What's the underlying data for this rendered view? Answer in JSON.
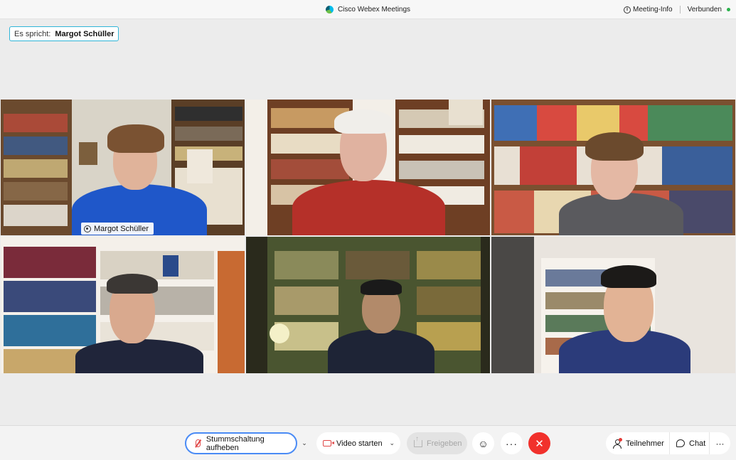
{
  "window": {
    "app_title": "Cisco Webex Meetings",
    "meeting_info_label": "Meeting-Info",
    "status_label": "Verbunden"
  },
  "speaking": {
    "prefix": "Es spricht:",
    "name": "Margot Schüller"
  },
  "tiles": [
    {
      "name_label": "Margot Schüller",
      "active_speaker": true
    },
    {
      "name_label": "",
      "active_speaker": false
    },
    {
      "name_label": "",
      "active_speaker": false
    },
    {
      "name_label": "",
      "active_speaker": false
    },
    {
      "name_label": "",
      "active_speaker": false
    },
    {
      "name_label": "",
      "active_speaker": false
    }
  ],
  "toolbar": {
    "unmute_label": "Stummschaltung aufheben",
    "video_label": "Video starten",
    "share_label": "Freigeben",
    "more_glyph": "···",
    "participants_label": "Teilnehmer",
    "chat_label": "Chat",
    "chevron_glyph": "⌄",
    "reaction_glyph": "☺",
    "leave_glyph": "✕",
    "more2_glyph": "···"
  },
  "colors": {
    "accent": "#2fb5d8",
    "leave": "#f1312c",
    "mute": "#e04747",
    "focus": "#4a8bf5"
  }
}
